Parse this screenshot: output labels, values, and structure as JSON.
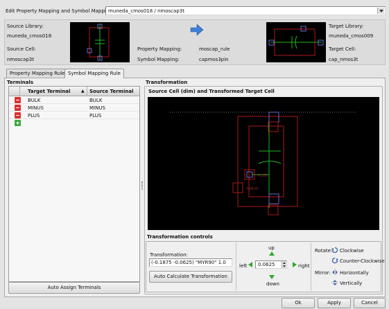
{
  "header": {
    "label": "Edit Property Mapping and Symbol Mapping for:",
    "selected": "muneda_cmos018 / nmoscap3t"
  },
  "source": {
    "library_label": "Source Library:",
    "library": "muneda_cmos018",
    "cell_label": "Source Cell:",
    "cell": "nmoscap3t"
  },
  "mapping": {
    "property_label": "Property Mapping:",
    "property": "moscap_rule",
    "symbol_label": "Symbol Mapping:",
    "symbol": "capmos3pin"
  },
  "target": {
    "library_label": "Target Library:",
    "library": "muneda_cmos009",
    "cell_label": "Target Cell:",
    "cell": "cap_nmos3t"
  },
  "tabs": [
    {
      "label": "Property Mapping Rule",
      "active": false
    },
    {
      "label": "Symbol Mapping Rule",
      "active": true
    }
  ],
  "terminals": {
    "title": "Terminals",
    "col_target": "Target Terminal",
    "col_source": "Source Terminal",
    "sort_glyph": "▲",
    "rows": [
      {
        "target": "BULK",
        "source": "BULK"
      },
      {
        "target": "MINUS",
        "source": "MINUS"
      },
      {
        "target": "PLUS",
        "source": "PLUS"
      }
    ],
    "auto_assign": "Auto Assign Terminals"
  },
  "transformation": {
    "title": "Transformation",
    "view_title": "Source Cell (dim) and Transformed Target Cell",
    "plus_label": "PLUS",
    "minus_label": "MINUS",
    "controls_title": "Transformation controls",
    "field_label": "Transformation:",
    "value": "(-0.1875 -0.0625) \"MYR90\" 1.0",
    "auto_calc": "Auto Calculate Transformation",
    "up": "up",
    "down": "down",
    "left": "left",
    "right": "right",
    "step": "0.0625",
    "rotate_label": "Rotate:",
    "clockwise": "Clockwise",
    "counter_clockwise": "Counter-Clockwise",
    "mirror_label": "Mirror:",
    "horizontally": "Horizontally",
    "vertically": "Vertically"
  },
  "footer": {
    "ok": "Ok",
    "apply": "Apply",
    "cancel": "Cancel"
  },
  "colors": {
    "shape": "#b01818",
    "pin": "#6a6ad0",
    "wire": "#1fb81f",
    "accent_arrow": "#3f7fd6",
    "nudge_arrow": "#2ea82e"
  }
}
